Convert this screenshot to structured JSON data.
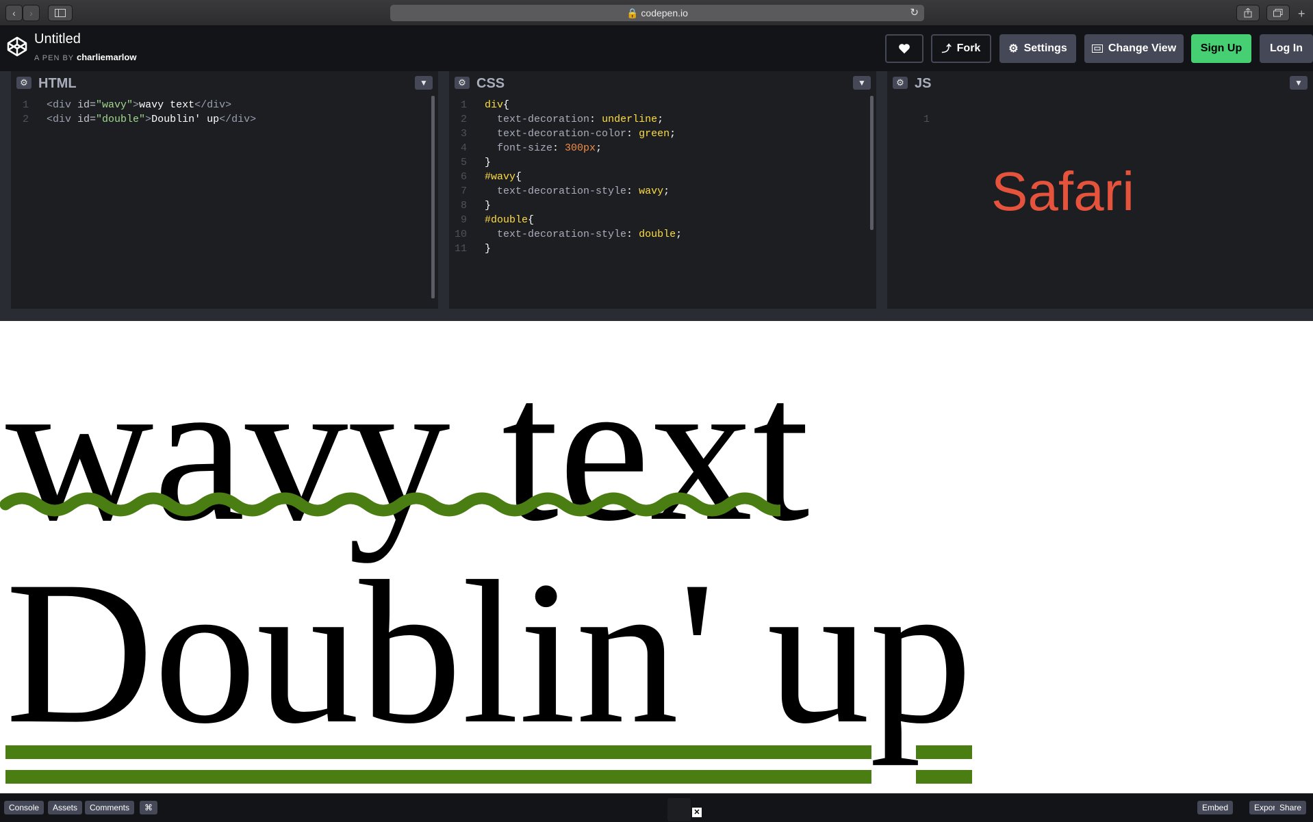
{
  "browser": {
    "url": "codepen.io"
  },
  "header": {
    "title": "Untitled",
    "by_prefix": "A PEN BY",
    "author": "charliemarlow",
    "buttons": {
      "fork": "Fork",
      "settings": "Settings",
      "change_view": "Change View",
      "sign_up": "Sign Up",
      "log_in": "Log In"
    },
    "sign_up_color": "#47cf73"
  },
  "panes": {
    "html": {
      "title": "HTML",
      "lines": [
        {
          "n": "1",
          "tokens": [
            [
              "t-tag",
              "<div "
            ],
            [
              "t-attr",
              "id="
            ],
            [
              "t-str",
              "\"wavy\""
            ],
            [
              "t-tag",
              ">"
            ],
            [
              "",
              "wavy text"
            ],
            [
              "t-tag",
              "</div>"
            ]
          ]
        },
        {
          "n": "2",
          "tokens": [
            [
              "t-tag",
              "<div "
            ],
            [
              "t-attr",
              "id="
            ],
            [
              "t-str",
              "\"double\""
            ],
            [
              "t-tag",
              ">"
            ],
            [
              "",
              "Doublin' up"
            ],
            [
              "t-tag",
              "</div>"
            ]
          ]
        }
      ]
    },
    "css": {
      "title": "CSS",
      "lines": [
        {
          "n": "1",
          "tokens": [
            [
              "t-sel",
              "div"
            ],
            [
              "",
              "{"
            ]
          ]
        },
        {
          "n": "2",
          "tokens": [
            [
              "",
              "  "
            ],
            [
              "t-prop",
              "text-decoration"
            ],
            [
              "",
              ": "
            ],
            [
              "t-val",
              "underline"
            ],
            [
              "",
              ";"
            ]
          ]
        },
        {
          "n": "3",
          "tokens": [
            [
              "",
              "  "
            ],
            [
              "t-prop",
              "text-decoration-color"
            ],
            [
              "",
              ": "
            ],
            [
              "t-val",
              "green"
            ],
            [
              "",
              ";"
            ]
          ]
        },
        {
          "n": "4",
          "tokens": [
            [
              "",
              "  "
            ],
            [
              "t-prop",
              "font-size"
            ],
            [
              "",
              ": "
            ],
            [
              "t-num",
              "300px"
            ],
            [
              "",
              ";"
            ]
          ]
        },
        {
          "n": "5",
          "tokens": [
            [
              "",
              "}"
            ]
          ]
        },
        {
          "n": "6",
          "tokens": [
            [
              "t-sel",
              "#wavy"
            ],
            [
              "",
              "{"
            ]
          ]
        },
        {
          "n": "7",
          "tokens": [
            [
              "",
              "  "
            ],
            [
              "t-prop",
              "text-decoration-style"
            ],
            [
              "",
              ": "
            ],
            [
              "t-val",
              "wavy"
            ],
            [
              "",
              ";"
            ]
          ]
        },
        {
          "n": "8",
          "tokens": [
            [
              "",
              "}"
            ]
          ]
        },
        {
          "n": "9",
          "tokens": [
            [
              "t-sel",
              "#double"
            ],
            [
              "",
              "{"
            ]
          ]
        },
        {
          "n": "10",
          "tokens": [
            [
              "",
              "  "
            ],
            [
              "t-prop",
              "text-decoration-style"
            ],
            [
              "",
              ": "
            ],
            [
              "t-val",
              "double"
            ],
            [
              "",
              ";"
            ]
          ]
        },
        {
          "n": "11",
          "tokens": [
            [
              "",
              "}"
            ]
          ]
        }
      ]
    },
    "js": {
      "title": "JS",
      "line_number": "1",
      "overlay_text": "Safari",
      "overlay_color": "#e5533c"
    }
  },
  "preview": {
    "line1": "wavy text",
    "line2": "Doublin' up",
    "decoration_color": "#4a7e12"
  },
  "footer": {
    "console": "Console",
    "assets": "Assets",
    "comments": "Comments",
    "shortcut_icon": "command-icon",
    "embed": "Embed",
    "export": "Export",
    "share": "Share"
  }
}
